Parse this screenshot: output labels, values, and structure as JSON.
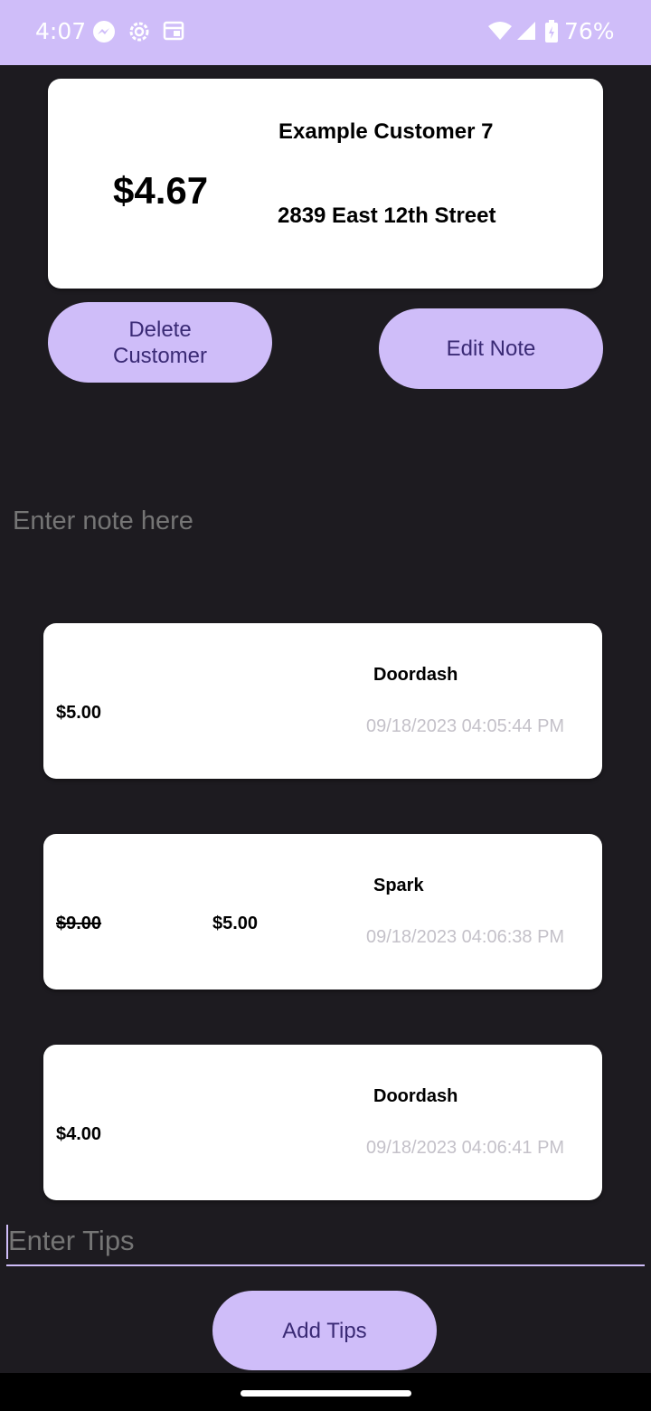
{
  "status_bar": {
    "time": "4:07",
    "battery": "76%",
    "icons": [
      "messenger-icon",
      "settings-icon",
      "calendar-icon",
      "wifi-icon",
      "signal-icon",
      "battery-icon"
    ]
  },
  "customer": {
    "amount": "$4.67",
    "name": "Example Customer 7",
    "address": "2839 East 12th Street"
  },
  "buttons": {
    "delete": "Delete Customer",
    "edit_note": "Edit Note",
    "add_tips": "Add Tips"
  },
  "note": {
    "placeholder": "Enter note here"
  },
  "tips": [
    {
      "amount": "$5.00",
      "source": "Doordash",
      "timestamp": "09/18/2023 04:05:44 PM"
    },
    {
      "original_amount": "$9.00",
      "amount": "$5.00",
      "source": "Spark",
      "timestamp": "09/18/2023 04:06:38 PM"
    },
    {
      "amount": "$4.00",
      "source": "Doordash",
      "timestamp": "09/18/2023 04:06:41 PM"
    }
  ],
  "tips_input": {
    "placeholder": "Enter Tips"
  },
  "colors": {
    "accent": "#cfbdf9",
    "accent_text": "#3a2a75",
    "background": "#1d1b20",
    "card": "#ffffff"
  }
}
